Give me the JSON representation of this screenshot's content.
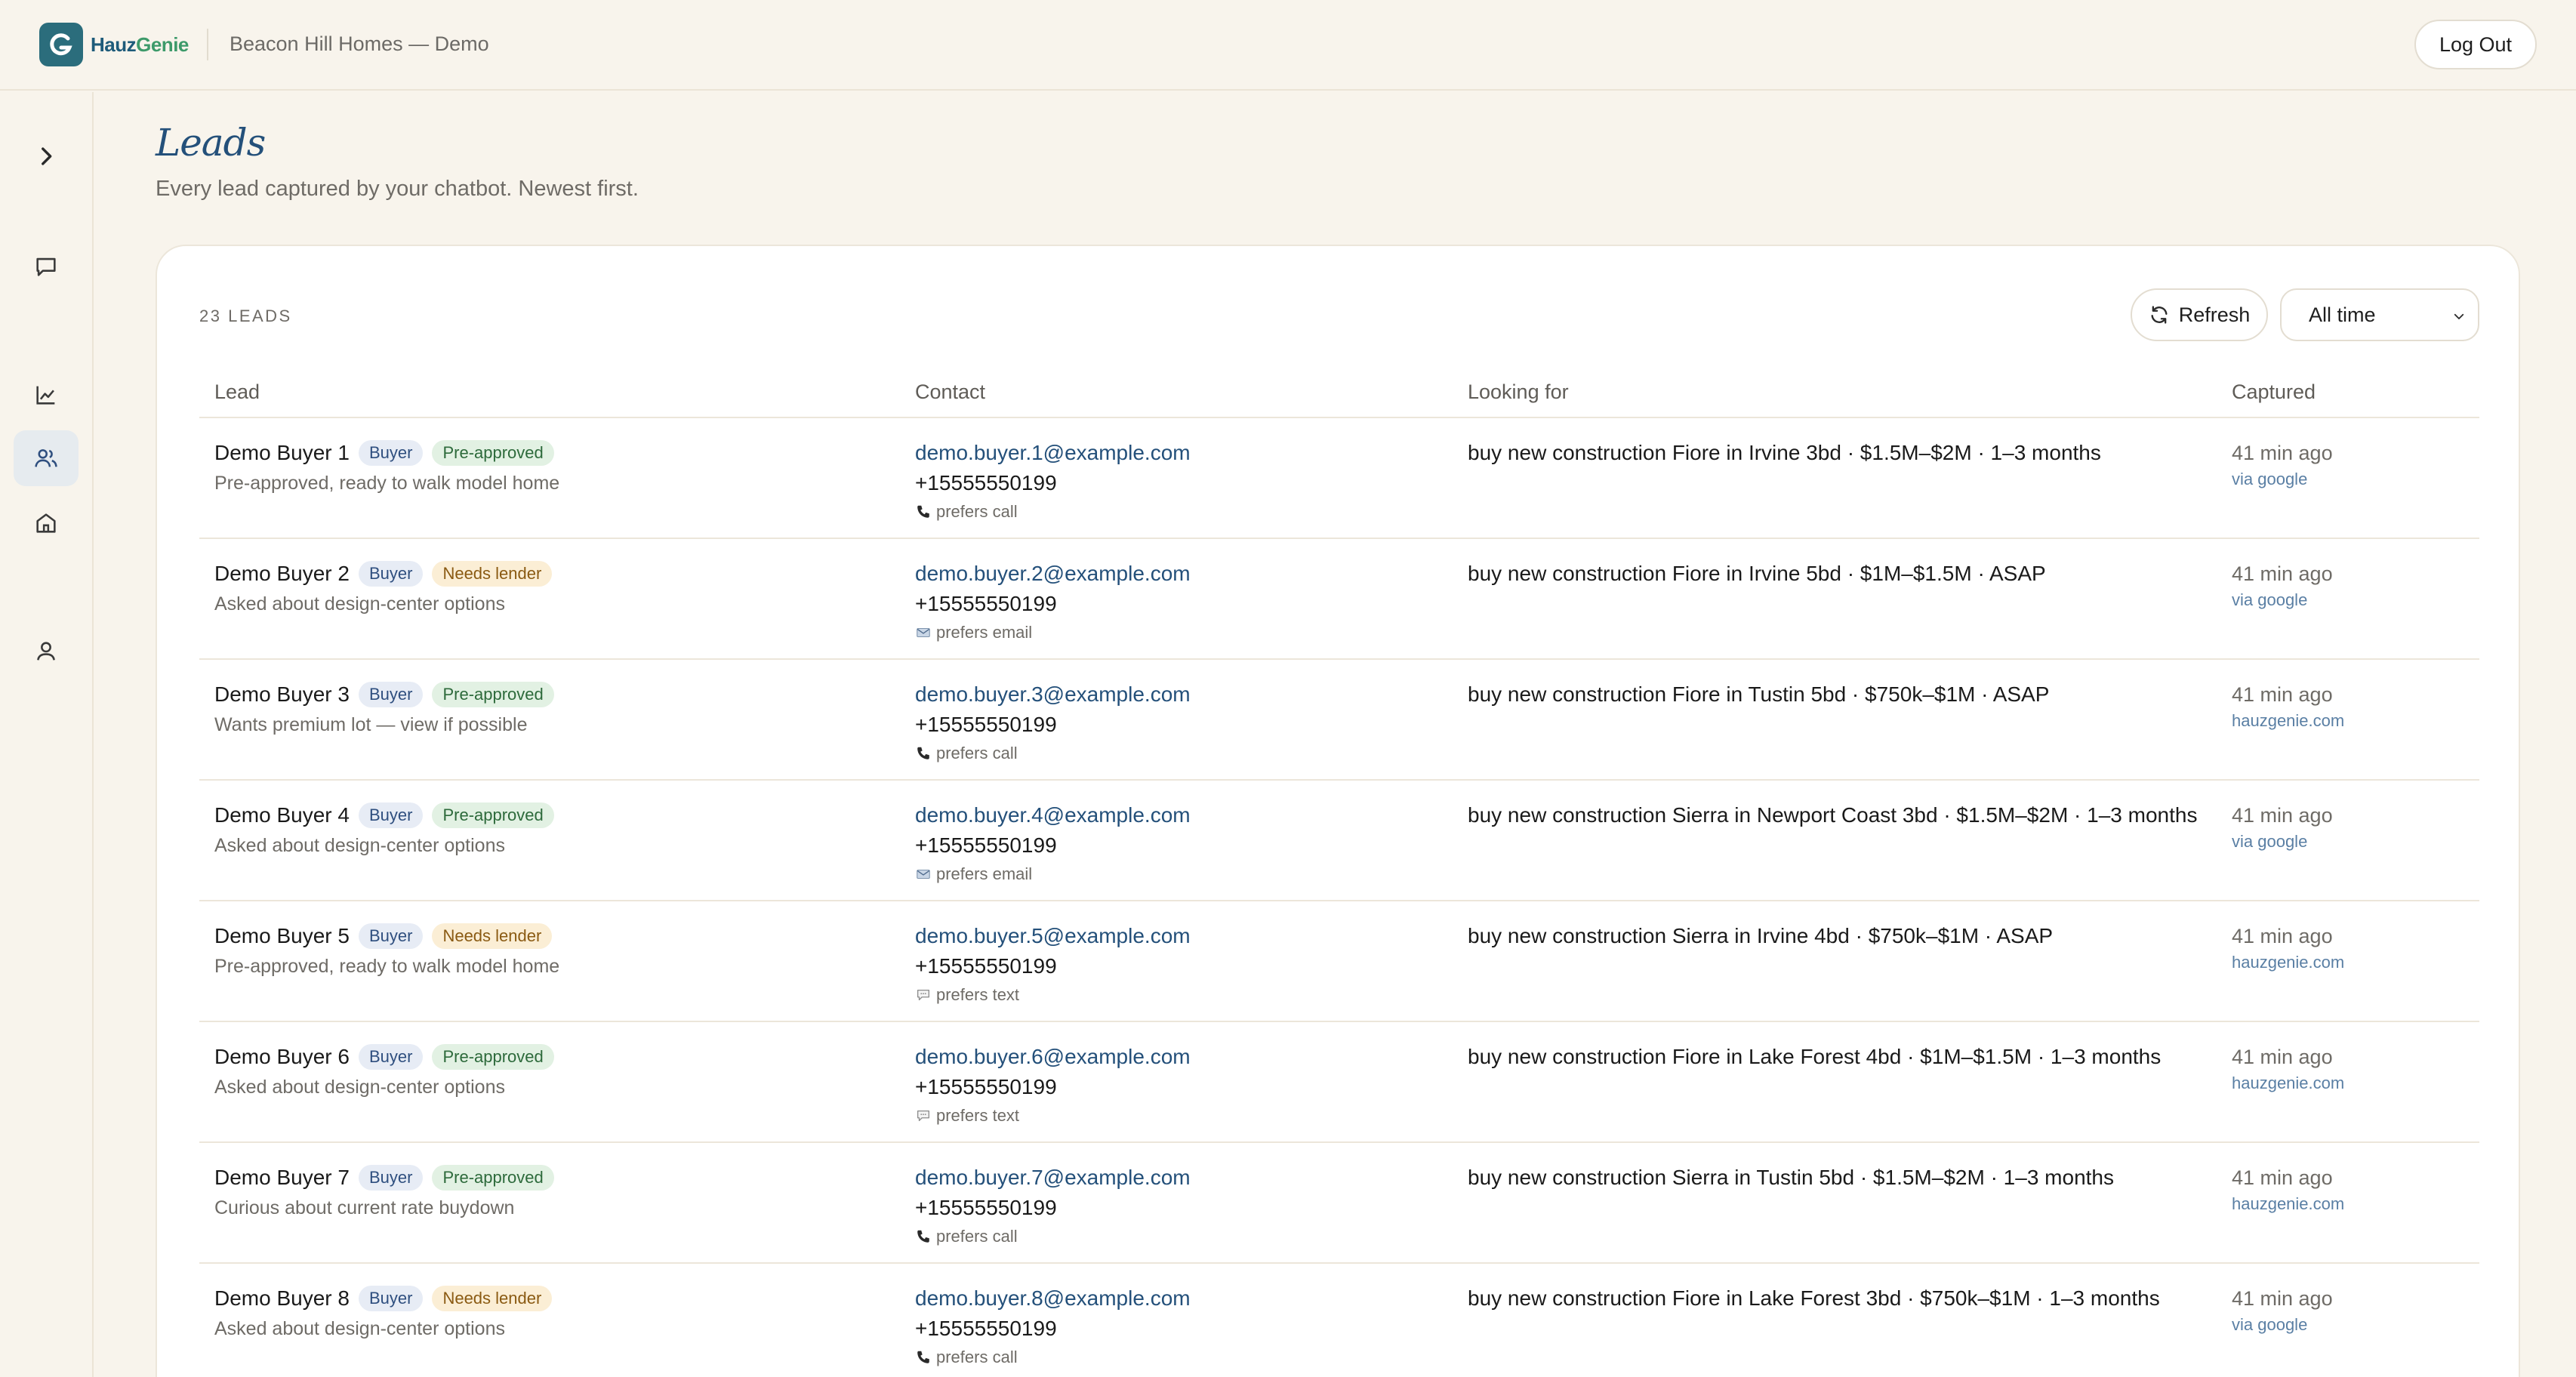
{
  "topbar": {
    "logo_mark": "G",
    "logo_part1": "Hauz",
    "logo_part2": "Genie",
    "workspace": "Beacon Hill Homes — Demo",
    "logout_label": "Log Out"
  },
  "sidebar": {
    "items": [
      {
        "name": "expand",
        "icon": "chevron-right-icon"
      },
      {
        "name": "conversations",
        "icon": "chat-icon"
      },
      {
        "name": "analytics",
        "icon": "chart-line-icon"
      },
      {
        "name": "leads",
        "icon": "users-icon",
        "active": true
      },
      {
        "name": "listings",
        "icon": "home-icon"
      },
      {
        "name": "account",
        "icon": "user-icon"
      }
    ]
  },
  "page": {
    "title": "Leads",
    "subtitle": "Every lead captured by your chatbot. Newest first."
  },
  "toolbar": {
    "count_label": "23 LEADS",
    "refresh_label": "Refresh",
    "range_value": "All time"
  },
  "table": {
    "headers": [
      "Lead",
      "Contact",
      "Looking for",
      "Captured"
    ],
    "rows": [
      {
        "name": "Demo Buyer 1",
        "role": "Buyer",
        "status": "Pre-approved",
        "status_kind": "approved",
        "note": "Pre-approved, ready to walk model home",
        "email": "demo.buyer.1@example.com",
        "phone": "+15555550199",
        "pref": "prefers call",
        "pref_icon": "phone-icon",
        "looking": "buy new construction Fiore in Irvine 3bd · $1.5M–$2M · 1–3 months",
        "captured": "41 min ago",
        "source": "via google"
      },
      {
        "name": "Demo Buyer 2",
        "role": "Buyer",
        "status": "Needs lender",
        "status_kind": "lender",
        "note": "Asked about design-center options",
        "email": "demo.buyer.2@example.com",
        "phone": "+15555550199",
        "pref": "prefers email",
        "pref_icon": "email-icon",
        "looking": "buy new construction Fiore in Irvine 5bd · $1M–$1.5M · ASAP",
        "captured": "41 min ago",
        "source": "via google"
      },
      {
        "name": "Demo Buyer 3",
        "role": "Buyer",
        "status": "Pre-approved",
        "status_kind": "approved",
        "note": "Wants premium lot — view if possible",
        "email": "demo.buyer.3@example.com",
        "phone": "+15555550199",
        "pref": "prefers call",
        "pref_icon": "phone-icon",
        "looking": "buy new construction Fiore in Tustin 5bd · $750k–$1M · ASAP",
        "captured": "41 min ago",
        "source": "hauzgenie.com"
      },
      {
        "name": "Demo Buyer 4",
        "role": "Buyer",
        "status": "Pre-approved",
        "status_kind": "approved",
        "note": "Asked about design-center options",
        "email": "demo.buyer.4@example.com",
        "phone": "+15555550199",
        "pref": "prefers email",
        "pref_icon": "email-icon",
        "looking": "buy new construction Sierra in Newport Coast 3bd · $1.5M–$2M · 1–3 months",
        "captured": "41 min ago",
        "source": "via google"
      },
      {
        "name": "Demo Buyer 5",
        "role": "Buyer",
        "status": "Needs lender",
        "status_kind": "lender",
        "note": "Pre-approved, ready to walk model home",
        "email": "demo.buyer.5@example.com",
        "phone": "+15555550199",
        "pref": "prefers text",
        "pref_icon": "speech-bubble-icon",
        "looking": "buy new construction Sierra in Irvine 4bd · $750k–$1M · ASAP",
        "captured": "41 min ago",
        "source": "hauzgenie.com"
      },
      {
        "name": "Demo Buyer 6",
        "role": "Buyer",
        "status": "Pre-approved",
        "status_kind": "approved",
        "note": "Asked about design-center options",
        "email": "demo.buyer.6@example.com",
        "phone": "+15555550199",
        "pref": "prefers text",
        "pref_icon": "speech-bubble-icon",
        "looking": "buy new construction Fiore in Lake Forest 4bd · $1M–$1.5M · 1–3 months",
        "captured": "41 min ago",
        "source": "hauzgenie.com"
      },
      {
        "name": "Demo Buyer 7",
        "role": "Buyer",
        "status": "Pre-approved",
        "status_kind": "approved",
        "note": "Curious about current rate buydown",
        "email": "demo.buyer.7@example.com",
        "phone": "+15555550199",
        "pref": "prefers call",
        "pref_icon": "phone-icon",
        "looking": "buy new construction Sierra in Tustin 5bd · $1.5M–$2M · 1–3 months",
        "captured": "41 min ago",
        "source": "hauzgenie.com"
      },
      {
        "name": "Demo Buyer 8",
        "role": "Buyer",
        "status": "Needs lender",
        "status_kind": "lender",
        "note": "Asked about design-center options",
        "email": "demo.buyer.8@example.com",
        "phone": "+15555550199",
        "pref": "prefers call",
        "pref_icon": "phone-icon",
        "looking": "buy new construction Fiore in Lake Forest 3bd · $750k–$1M · 1–3 months",
        "captured": "41 min ago",
        "source": "via google"
      }
    ]
  },
  "colors": {
    "background": "#f8f4ec",
    "brand": "#2b6d7c",
    "link": "#24507a",
    "approved_bg": "#e2f1e3",
    "lender_bg": "#fbeed5",
    "buyer_bg": "#e7ecf5"
  }
}
